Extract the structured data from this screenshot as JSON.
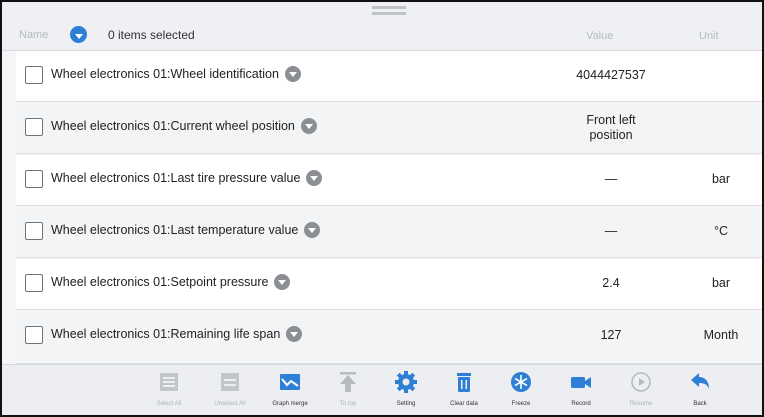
{
  "header": {
    "name_label": "Name",
    "selected_text": "0 items selected",
    "value_label": "Value",
    "unit_label": "Unit"
  },
  "rows": [
    {
      "label": "Wheel electronics 01:Wheel identification",
      "value": "4044427537",
      "unit": ""
    },
    {
      "label": "Wheel electronics 01:Current wheel position",
      "value_line1": "Front left",
      "value_line2": "position",
      "unit": ""
    },
    {
      "label": "Wheel electronics 01:Last tire pressure value",
      "value": "—",
      "unit": "bar"
    },
    {
      "label": "Wheel electronics 01:Last temperature value",
      "value": "—",
      "unit": "°C"
    },
    {
      "label": "Wheel electronics 01:Setpoint pressure",
      "value": "2.4",
      "unit": "bar"
    },
    {
      "label": "Wheel electronics 01:Remaining life span",
      "value": "127",
      "unit": "Month"
    }
  ],
  "toolbar": {
    "items": [
      {
        "label": "Select All",
        "icon": "select-all-icon",
        "enabled": false
      },
      {
        "label": "Unselect All",
        "icon": "unselect-all-icon",
        "enabled": false
      },
      {
        "label": "Graph merge",
        "icon": "graph-merge-icon",
        "enabled": true
      },
      {
        "label": "To top",
        "icon": "to-top-icon",
        "enabled": false
      },
      {
        "label": "Setting",
        "icon": "gear-icon",
        "enabled": true
      },
      {
        "label": "Clear data",
        "icon": "trash-icon",
        "enabled": true
      },
      {
        "label": "Freeze",
        "icon": "freeze-icon",
        "enabled": true
      },
      {
        "label": "Record",
        "icon": "video-camera-icon",
        "enabled": true
      },
      {
        "label": "Resume",
        "icon": "play-icon",
        "enabled": false
      },
      {
        "label": "Back",
        "icon": "back-arrow-icon",
        "enabled": true
      }
    ]
  },
  "colors": {
    "accent": "#2e7fd6",
    "disabled": "#aeb2b7",
    "info_icon": "#8b8e93"
  }
}
